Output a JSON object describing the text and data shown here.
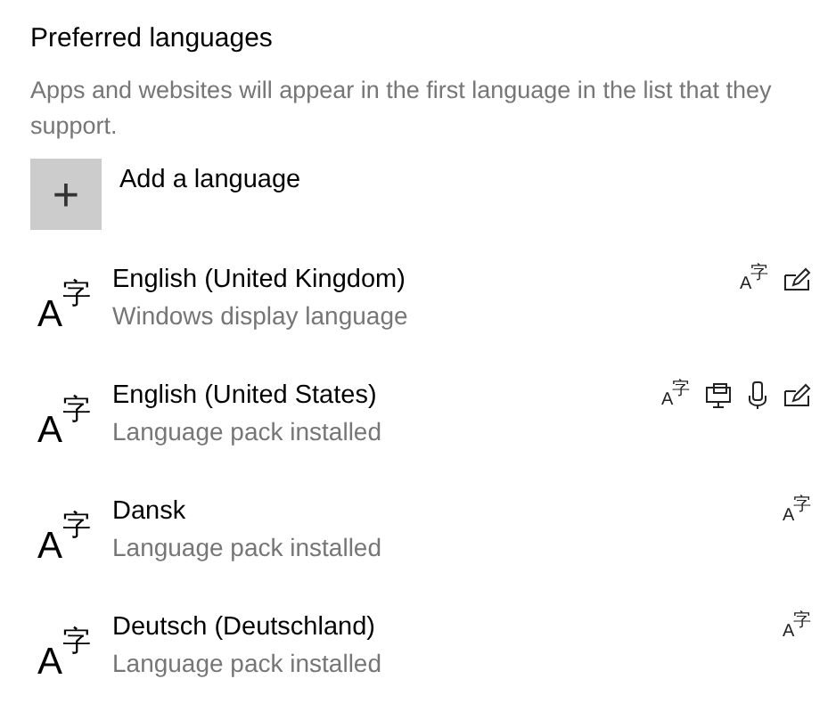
{
  "heading": "Preferred languages",
  "description": "Apps and websites will appear in the first language in the list that they support.",
  "add_button": {
    "icon": "+",
    "label": "Add a language"
  },
  "languages": [
    {
      "name": "English (United Kingdom)",
      "status": "Windows display language",
      "glyph_latin": "A",
      "glyph_cjk": "字",
      "features": [
        {
          "kind": "typing",
          "glyph_latin": "A",
          "glyph_cjk": "字"
        },
        {
          "kind": "handwriting"
        }
      ]
    },
    {
      "name": "English (United States)",
      "status": "Language pack installed",
      "glyph_latin": "A",
      "glyph_cjk": "字",
      "features": [
        {
          "kind": "typing",
          "glyph_latin": "A",
          "glyph_cjk": "字"
        },
        {
          "kind": "display"
        },
        {
          "kind": "speech"
        },
        {
          "kind": "handwriting"
        }
      ]
    },
    {
      "name": "Dansk",
      "status": "Language pack installed",
      "glyph_latin": "A",
      "glyph_cjk": "字",
      "features": [
        {
          "kind": "typing",
          "glyph_latin": "A",
          "glyph_cjk": "字"
        }
      ]
    },
    {
      "name": "Deutsch (Deutschland)",
      "status": "Language pack installed",
      "glyph_latin": "A",
      "glyph_cjk": "字",
      "features": [
        {
          "kind": "typing",
          "glyph_latin": "A",
          "glyph_cjk": "字"
        }
      ]
    }
  ]
}
